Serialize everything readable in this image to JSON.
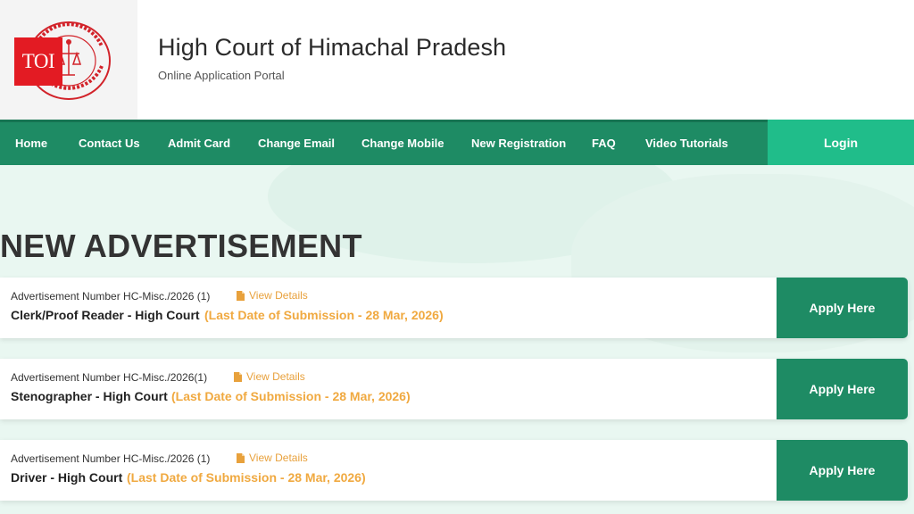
{
  "header": {
    "logo_overlay": "TOI",
    "seal_text": "HIGH COURT OF HIMACHAL PRADESH SHIMLA",
    "title": "High Court of Himachal Pradesh",
    "subtitle": "Online Application Portal"
  },
  "nav": {
    "items": [
      {
        "label": "Home"
      },
      {
        "label": "Contact Us"
      },
      {
        "label": "Admit Card"
      },
      {
        "label": "Change Email"
      },
      {
        "label": "Change Mobile"
      },
      {
        "label": "New Registration"
      },
      {
        "label": "FAQ"
      },
      {
        "label": "Video Tutorials"
      }
    ],
    "login": "Login"
  },
  "main": {
    "heading": "NEW ADVERTISEMENT",
    "advertisements": [
      {
        "number": "Advertisement Number HC-Misc./2026 (1)",
        "view_label": "View Details",
        "post": "Clerk/Proof Reader - High Court",
        "deadline": "(Last Date of Submission - 28 Mar, 2026)",
        "apply_label": "Apply Here"
      },
      {
        "number": "Advertisement Number HC-Misc./2026(1)",
        "view_label": "View Details",
        "post": "Stenographer - High Court",
        "deadline": "(Last Date of Submission - 28 Mar, 2026)",
        "apply_label": "Apply Here"
      },
      {
        "number": "Advertisement Number HC-Misc./2026 (1)",
        "view_label": "View Details",
        "post": "Driver - High Court",
        "deadline": "(Last Date of Submission - 28 Mar, 2026)",
        "apply_label": "Apply Here"
      }
    ]
  },
  "colors": {
    "primary": "#1e8b64",
    "login": "#20bd8a",
    "accent_orange": "#f0a940",
    "toi_red": "#e31b23",
    "seal_red": "#d2232a"
  }
}
